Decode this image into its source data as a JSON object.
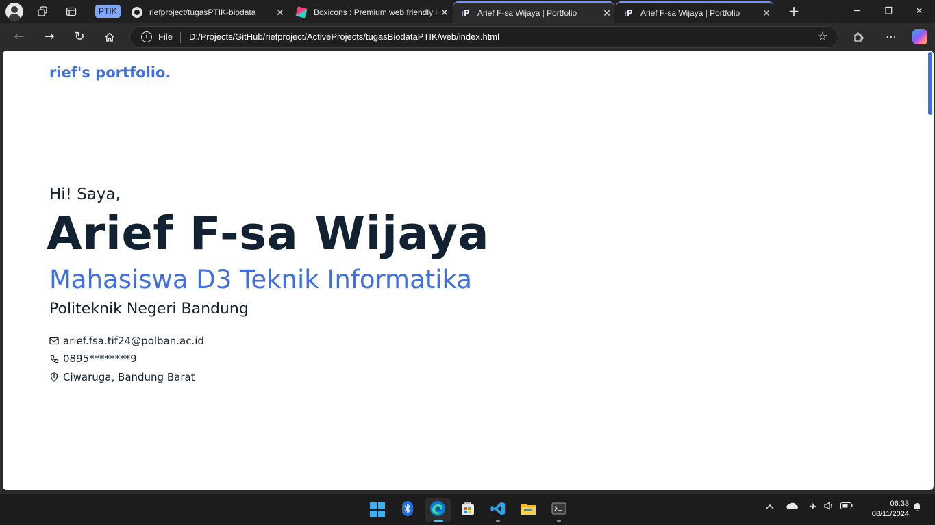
{
  "browser": {
    "tab_group_label": "PTIK",
    "tabs": [
      {
        "title": "riefproject/tugasPTIK-biodata",
        "icon": "github-icon",
        "active": false
      },
      {
        "title": "Boxicons : Premium web friendly icons",
        "icon": "boxicons-icon",
        "active": false
      },
      {
        "title": "Arief F-sa Wijaya | Portfolio",
        "icon": "rp-logo-icon",
        "active": true
      },
      {
        "title": "Arief F-sa Wijaya | Portfolio",
        "icon": "rp-logo-icon",
        "active": false
      }
    ],
    "address_scheme": "File",
    "address_url": "D:/Projects/GitHub/riefproject/ActiveProjects/tugasBiodataPTIK/web/index.html",
    "accent": "#6d96f0"
  },
  "page": {
    "brand": "rief's portfolio.",
    "greeting": "Hi! Saya,",
    "name": "Arief F-sa Wijaya",
    "role": "Mahasiswa D3 Teknik Informatika",
    "school": "Politeknik Negeri Bandung",
    "contacts": [
      {
        "icon": "envelope-icon",
        "text": "arief.fsa.tif24@polban.ac.id"
      },
      {
        "icon": "phone-icon",
        "text": "0895********9"
      },
      {
        "icon": "map-pin-icon",
        "text": "Ciwaruga, Bandung Barat"
      }
    ],
    "colors": {
      "primary": "#3f6fe0",
      "text": "#132232"
    }
  },
  "taskbar": {
    "apps": [
      "start-icon",
      "bluetooth-icon",
      "edge-icon",
      "store-icon",
      "vscode-icon",
      "file-explorer-icon",
      "terminal-icon"
    ],
    "time": "06:33",
    "date": "08/11/2024"
  }
}
